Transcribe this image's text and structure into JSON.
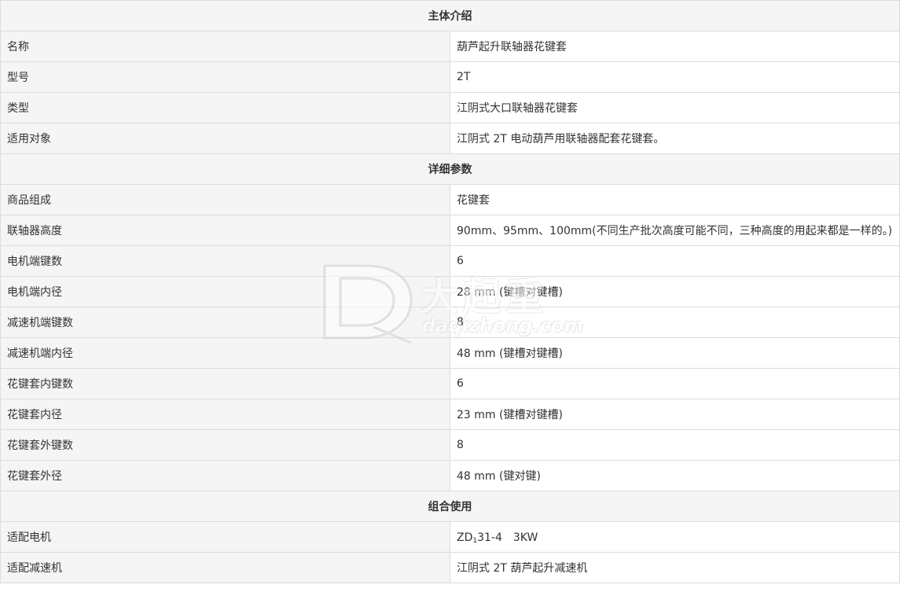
{
  "sections": [
    {
      "title": "主体介绍",
      "rows": [
        {
          "label": "名称",
          "value": "葫芦起升联轴器花键套"
        },
        {
          "label": "型号",
          "value": "2T"
        },
        {
          "label": "类型",
          "value": "江阴式大口联轴器花键套"
        },
        {
          "label": "适用对象",
          "value": "江阴式 2T 电动葫芦用联轴器配套花键套。"
        }
      ]
    },
    {
      "title": "详细参数",
      "rows": [
        {
          "label": "商品组成",
          "value": "花键套"
        },
        {
          "label": "联轴器高度",
          "value": "90mm、95mm、100mm(不同生产批次高度可能不同，三种高度的用起来都是一样的。)"
        },
        {
          "label": "电机端键数",
          "value": "6"
        },
        {
          "label": "电机端内径",
          "value": "28 mm (键槽对键槽)"
        },
        {
          "label": "减速机端键数",
          "value": "8"
        },
        {
          "label": "减速机端内径",
          "value": "48 mm (键槽对键槽)"
        },
        {
          "label": "花键套内键数",
          "value": "6"
        },
        {
          "label": "花键套内径",
          "value": "23 mm (键槽对键槽)"
        },
        {
          "label": "花键套外键数",
          "value": "8"
        },
        {
          "label": "花键套外径",
          "value": "48 mm (键对键)"
        }
      ]
    },
    {
      "title": "组合使用",
      "rows": [
        {
          "label": "适配电机",
          "value_pre": "ZD",
          "value_sub": "1",
          "value_post": "31-4　3KW"
        },
        {
          "label": "适配减速机",
          "value": "江阴式 2T 葫芦起升减速机"
        }
      ]
    }
  ],
  "watermark": {
    "text_cn": "大起重",
    "text_en": "daqizhong.com",
    "logo": "dq-logo-icon"
  }
}
